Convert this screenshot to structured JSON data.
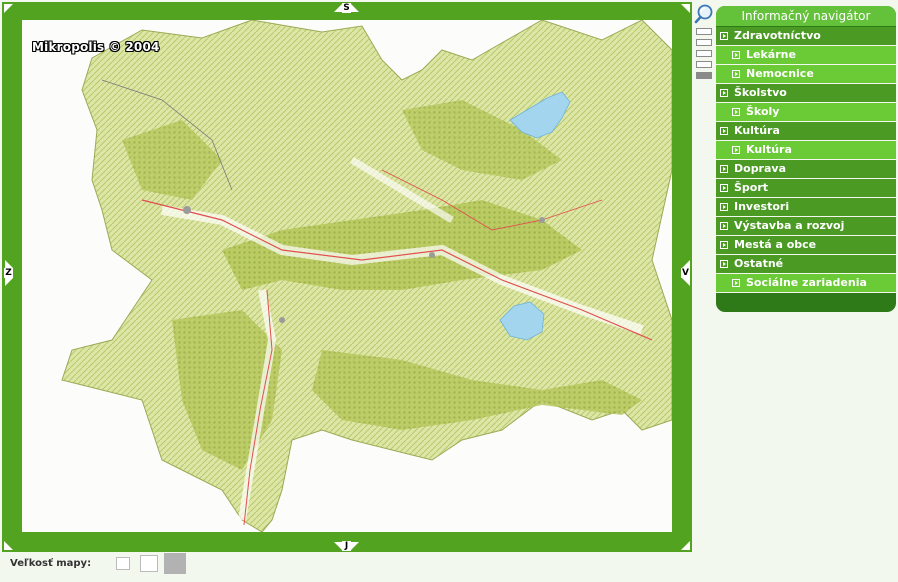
{
  "map": {
    "copyright": "Mikropolis © 2004",
    "pan": {
      "north": "S",
      "south": "J",
      "west": "Z",
      "east": "V"
    }
  },
  "zoom": {
    "icon": "magnifier-icon",
    "levels": 5,
    "active_level": 5
  },
  "navigator": {
    "title": "Informačný navigátor",
    "items": [
      {
        "label": "Zdravotníctvo",
        "level": "category"
      },
      {
        "label": "Lekárne",
        "level": "sub"
      },
      {
        "label": "Nemocnice",
        "level": "sub"
      },
      {
        "label": "Školstvo",
        "level": "category"
      },
      {
        "label": "Školy",
        "level": "sub"
      },
      {
        "label": "Kultúra",
        "level": "category"
      },
      {
        "label": "Kultúra",
        "level": "sub"
      },
      {
        "label": "Doprava",
        "level": "category"
      },
      {
        "label": "Šport",
        "level": "category"
      },
      {
        "label": "Investori",
        "level": "category"
      },
      {
        "label": "Výstavba a rozvoj",
        "level": "category"
      },
      {
        "label": "Mestá a obce",
        "level": "category"
      },
      {
        "label": "Ostatné",
        "level": "category"
      },
      {
        "label": "Sociálne zariadenia",
        "level": "sub"
      }
    ]
  },
  "map_size": {
    "label": "Veľkosť mapy:"
  },
  "colors": {
    "frame": "#52a31f",
    "nav_category": "#4a9a24",
    "nav_sub": "#6acb37",
    "nav_dark": "#2e7a18",
    "lake": "#9fd4ec",
    "terrain": "#d8e29a",
    "forest": "#a9bd50"
  }
}
